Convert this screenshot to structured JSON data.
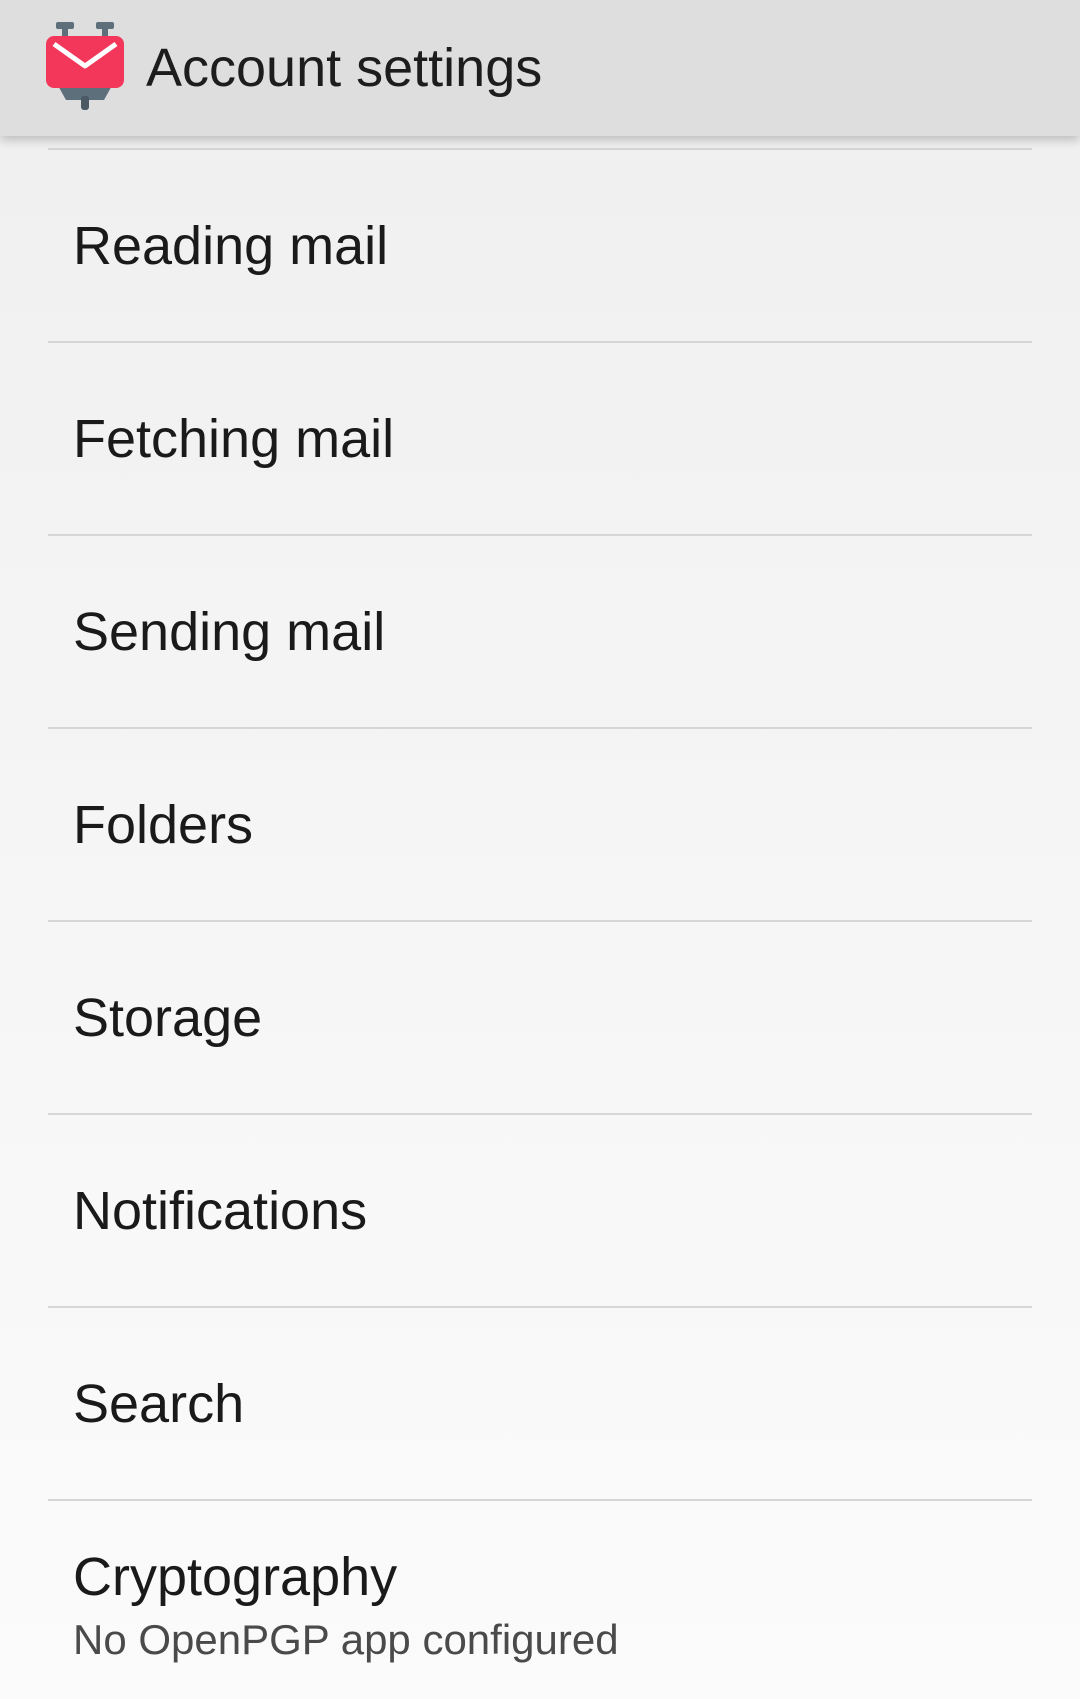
{
  "app_bar": {
    "title": "Account settings",
    "icon": "k9-mail-icon",
    "icon_colors": {
      "envelope": "#f2375a",
      "envelope_flap": "#ffffff",
      "robot_body": "#5d6f7b"
    }
  },
  "settings_items": [
    {
      "title": "Reading mail"
    },
    {
      "title": "Fetching mail"
    },
    {
      "title": "Sending mail"
    },
    {
      "title": "Folders"
    },
    {
      "title": "Storage"
    },
    {
      "title": "Notifications"
    },
    {
      "title": "Search"
    },
    {
      "title": "Cryptography",
      "summary": "No OpenPGP app configured"
    }
  ],
  "colors": {
    "app_bar_bg": "#dedede",
    "divider": "#d6d6d6",
    "text_primary": "#1a1a1a",
    "text_secondary": "#4a4a4a"
  }
}
